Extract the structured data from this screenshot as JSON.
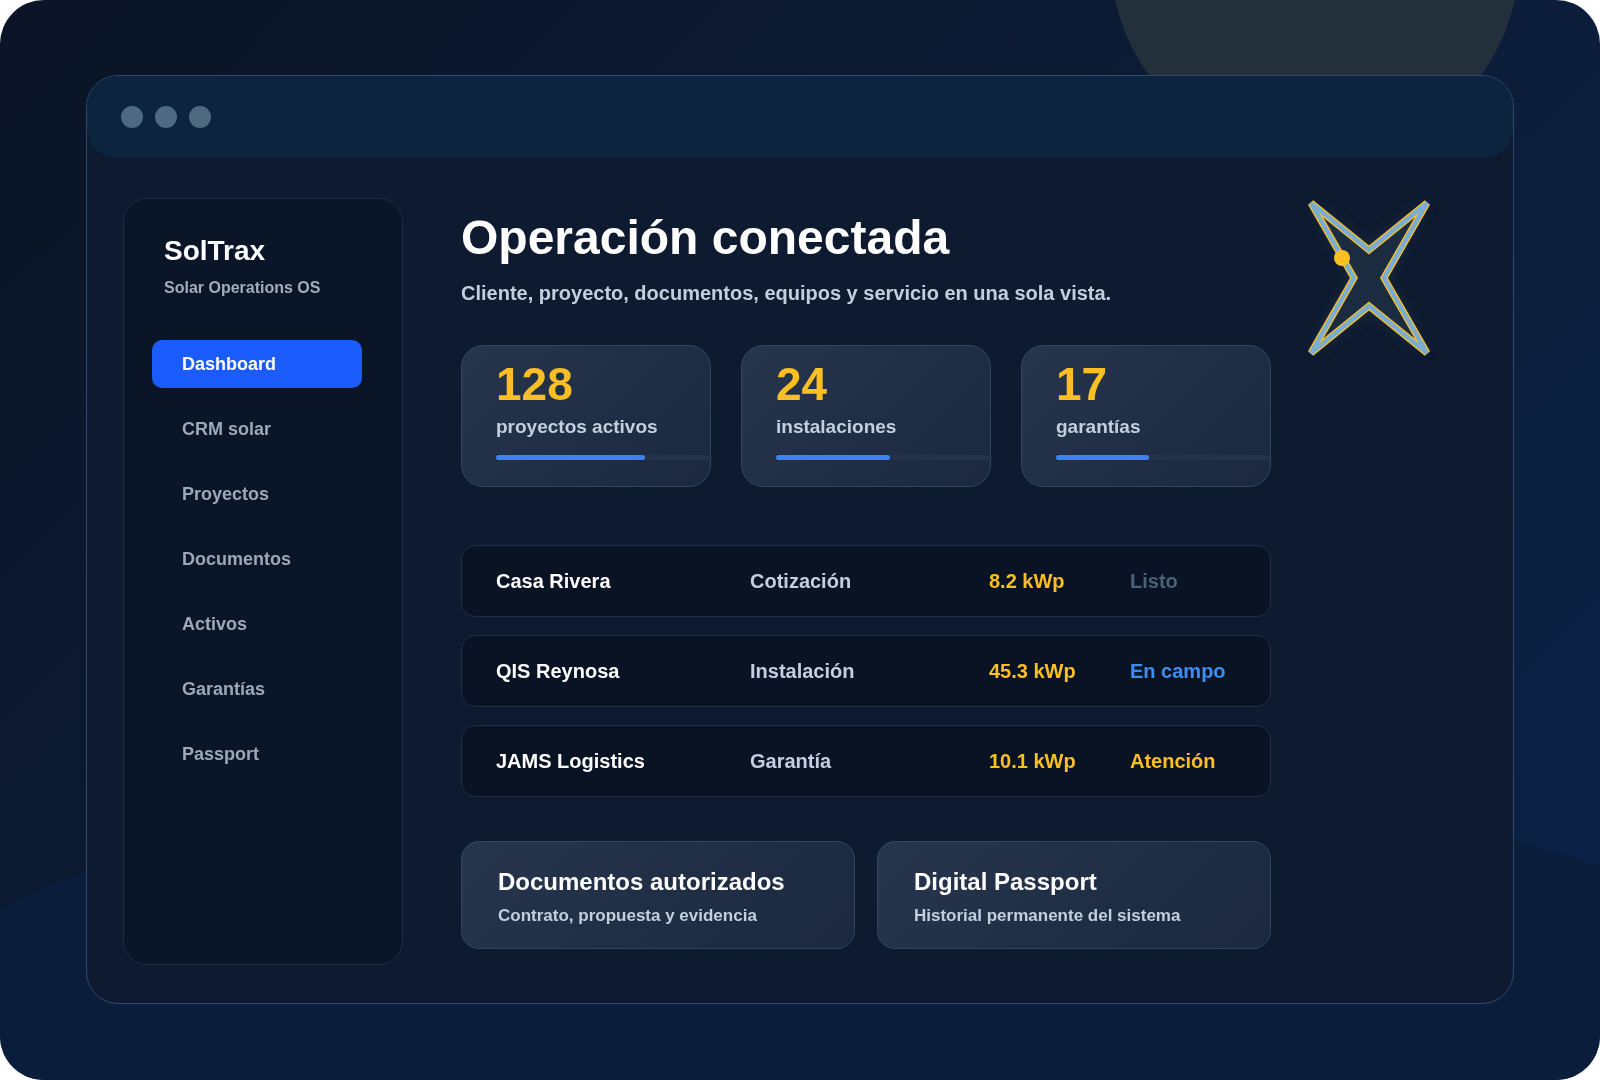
{
  "brand": {
    "name": "SolTrax",
    "tagline": "Solar Operations OS"
  },
  "nav": [
    {
      "label": "Dashboard",
      "selected": true
    },
    {
      "label": "CRM solar",
      "selected": false
    },
    {
      "label": "Proyectos",
      "selected": false
    },
    {
      "label": "Documentos",
      "selected": false
    },
    {
      "label": "Activos",
      "selected": false
    },
    {
      "label": "Garantías",
      "selected": false
    },
    {
      "label": "Passport",
      "selected": false
    }
  ],
  "header": {
    "title": "Operación conectada",
    "subtitle": "Cliente, proyecto, documentos, equipos y servicio en una sola vista."
  },
  "stats": [
    {
      "value": "128",
      "label": "proyectos activos",
      "level": 0.69
    },
    {
      "value": "24",
      "label": "instalaciones",
      "level": 0.53
    },
    {
      "value": "17",
      "label": "garantías",
      "level": 0.43
    }
  ],
  "projects": [
    {
      "name": "Casa Rivera",
      "stage": "Cotización",
      "power": "8.2 kWp",
      "status": "Listo",
      "color": "#4a6178"
    },
    {
      "name": "QIS Reynosa",
      "stage": "Instalación",
      "power": "45.3 kWp",
      "status": "En campo",
      "color": "#3b8ef5"
    },
    {
      "name": "JAMS Logistics",
      "stage": "Garantía",
      "power": "10.1 kWp",
      "status": "Atención",
      "color": "#fbbf24"
    }
  ],
  "features": [
    {
      "title": "Documentos autorizados",
      "subtitle": "Contrato, propuesta y evidencia"
    },
    {
      "title": "Digital Passport",
      "subtitle": "Historial permanente del sistema"
    }
  ]
}
